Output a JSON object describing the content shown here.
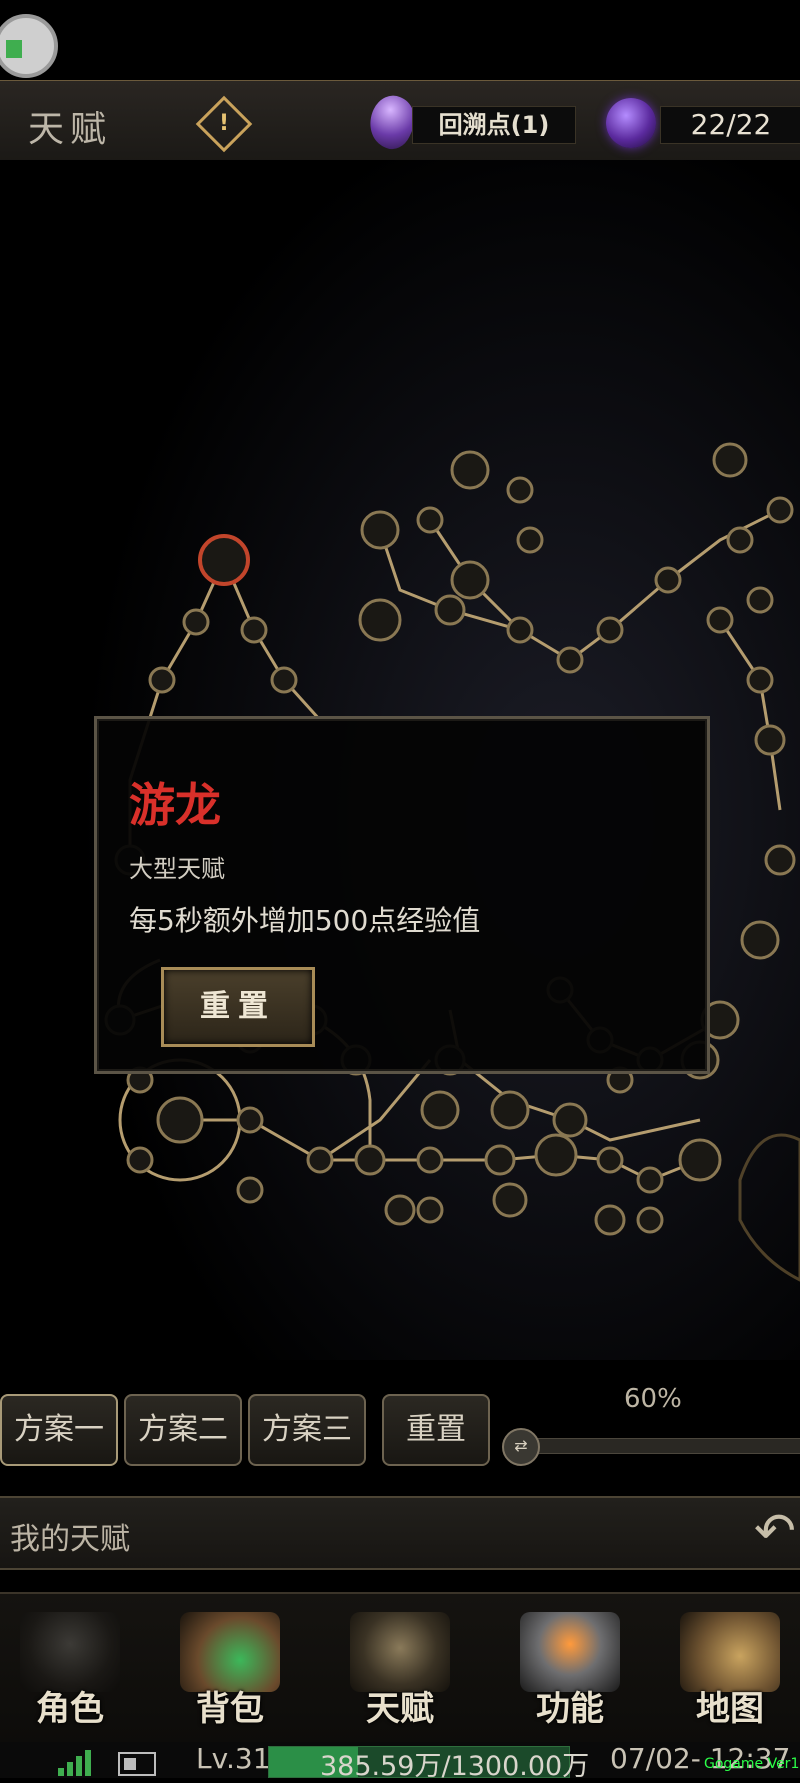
{
  "header": {
    "title": "天赋",
    "rewind_label": "回溯点(1)",
    "talent_points": "22/22"
  },
  "tooltip": {
    "name": "游龙",
    "type": "大型天赋",
    "description": "每5秒额外增加500点经验值",
    "reset_label": "重置"
  },
  "plans": [
    {
      "label": "方案一"
    },
    {
      "label": "方案二"
    },
    {
      "label": "方案三"
    }
  ],
  "plan_reset_label": "重置",
  "zoom": {
    "percent_label": "60%",
    "value": 0.6
  },
  "my_talent": {
    "label": "我的天赋"
  },
  "nav": [
    {
      "label": "角色",
      "icon": "hooded-character-icon"
    },
    {
      "label": "背包",
      "icon": "backpack-icon"
    },
    {
      "label": "天赋",
      "icon": "dragon-crest-icon"
    },
    {
      "label": "功能",
      "icon": "anvil-icon"
    },
    {
      "label": "地图",
      "icon": "map-compass-icon"
    }
  ],
  "status": {
    "level": "Lv.31",
    "exp_text": "385.59万/1300.00万",
    "exp_fraction": 0.297,
    "datetime": "07/02- 12:37",
    "badge": "Gogame Ver1"
  },
  "colors": {
    "accent_gold": "#a88c57",
    "talent_name_red": "#d9302a",
    "exp_green": "#2b8f47"
  }
}
